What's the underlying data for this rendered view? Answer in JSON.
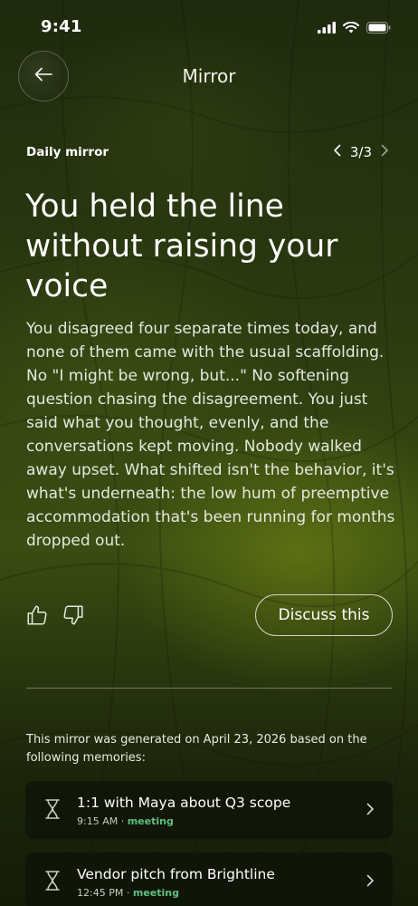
{
  "status_bar": {
    "time": "9:41"
  },
  "header": {
    "title": "Mirror"
  },
  "mirror": {
    "label": "Daily mirror",
    "pager": "3/3",
    "headline": "You held the line without raising your voice",
    "body": "You disagreed four separate times today, and none of them came with the usual scaffolding. No \"I might be wrong, but...\" No softening question chasing the disagreement. You just said what you thought, evenly, and the conversations kept moving. Nobody walked away upset. What shifted isn't the behavior, it's what's underneath: the low hum of preemptive accommodation that's been running for months dropped out.",
    "discuss_label": "Discuss this"
  },
  "generation_note": "This mirror was generated on April 23, 2026 based on the following memories:",
  "memories": [
    {
      "title": "1:1 with Maya about Q3 scope",
      "time": "9:15 AM",
      "separator": " · ",
      "tag": "meeting",
      "icon": "hourglass-icon"
    },
    {
      "title": "Vendor pitch from Brightline",
      "time": "12:45 PM",
      "separator": " · ",
      "tag": "meeting",
      "icon": "hourglass-icon"
    }
  ],
  "colors": {
    "accent_tag": "#5fbf7e",
    "background": "#2a3512"
  }
}
